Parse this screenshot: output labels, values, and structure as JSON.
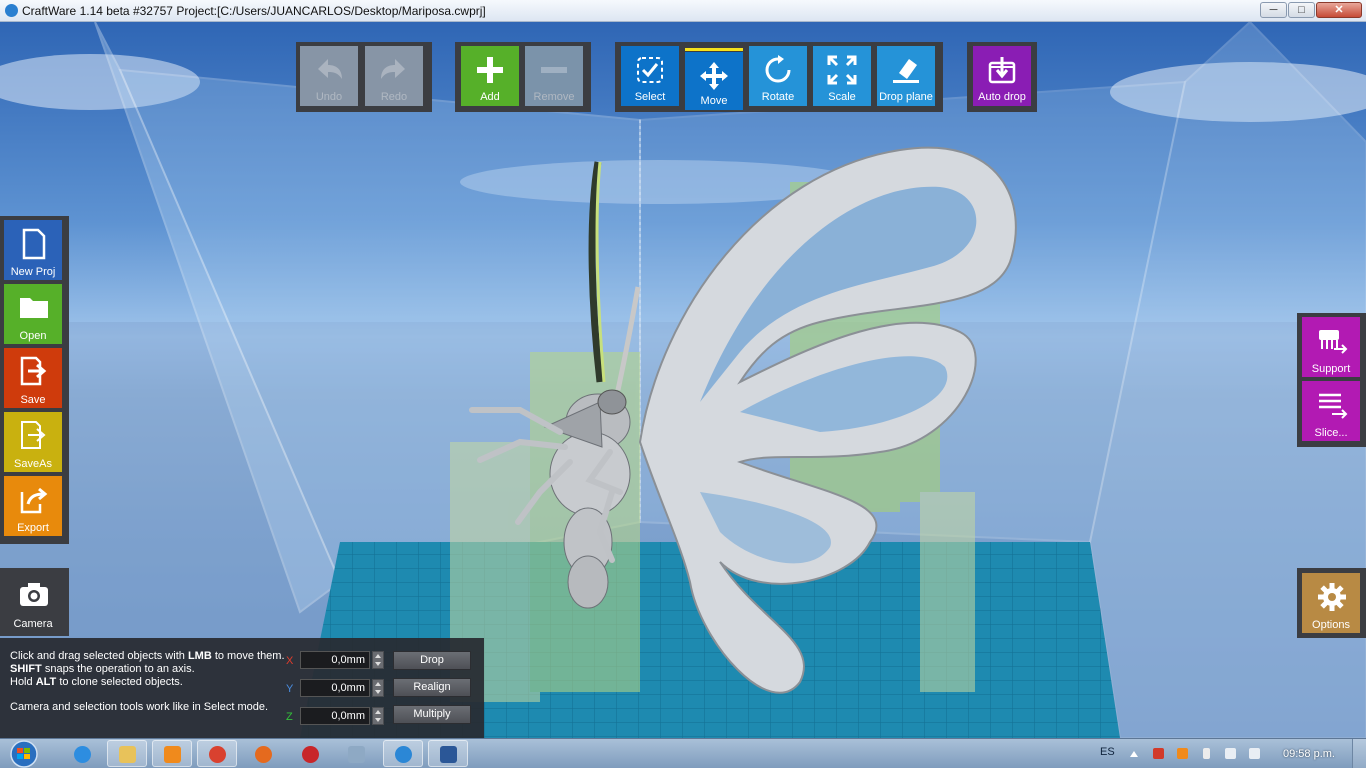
{
  "window": {
    "title": "CraftWare 1.14 beta #32757   Project:[C:/Users/JUANCARLOS/Desktop/Mariposa.cwprj]",
    "min_glyph": "─",
    "max_glyph": "□",
    "close_glyph": "✕"
  },
  "toolbar": {
    "undo": "Undo",
    "redo": "Redo",
    "add": "Add",
    "remove": "Remove",
    "select": "Select",
    "move": "Move",
    "rotate": "Rotate",
    "scale": "Scale",
    "drop_plane": "Drop plane",
    "auto_drop": "Auto drop"
  },
  "left_panel": {
    "new_proj": "New Proj",
    "open": "Open",
    "save": "Save",
    "saveas": "SaveAs",
    "export": "Export",
    "camera": "Camera"
  },
  "right_panel": {
    "support": "Support",
    "slice": "Slice...",
    "options": "Options"
  },
  "info": {
    "line1_pre": "Click and drag selected objects with ",
    "line1_bold": "LMB",
    "line1_post": " to move them.",
    "line2_bold": "SHIFT",
    "line2_post": " snaps the operation to an axis.",
    "line3_pre": "Hold ",
    "line3_bold": "ALT",
    "line3_post": " to clone selected objects.",
    "line4": "Camera and selection tools work like in Select mode.",
    "x_label": "X",
    "y_label": "Y",
    "z_label": "Z",
    "x_value": "0,0mm",
    "y_value": "0,0mm",
    "z_value": "0,0mm",
    "drop_btn": "Drop",
    "realign_btn": "Realign",
    "multiply_btn": "Multiply"
  },
  "taskbar": {
    "language": "ES",
    "clock": "09:58 p.m."
  },
  "colors": {
    "undo_disabled": "#8795a6",
    "add_green": "#56b029",
    "select_blue": "#0d73c9",
    "move_blue": "#0d73c9",
    "tool_cyan": "#2593d8",
    "auto_drop_purple": "#8a1db4",
    "support_magenta": "#b21ab3",
    "open_green": "#56b029",
    "save_red": "#cf3b0c",
    "saveas_yellow": "#c9b10f",
    "export_orange": "#e88a0c",
    "options_tan": "#b88a44",
    "active_indicator": "#f6e21c",
    "x_axis": "#e03c2c",
    "y_axis": "#4a8de0",
    "z_axis": "#33c13a"
  }
}
